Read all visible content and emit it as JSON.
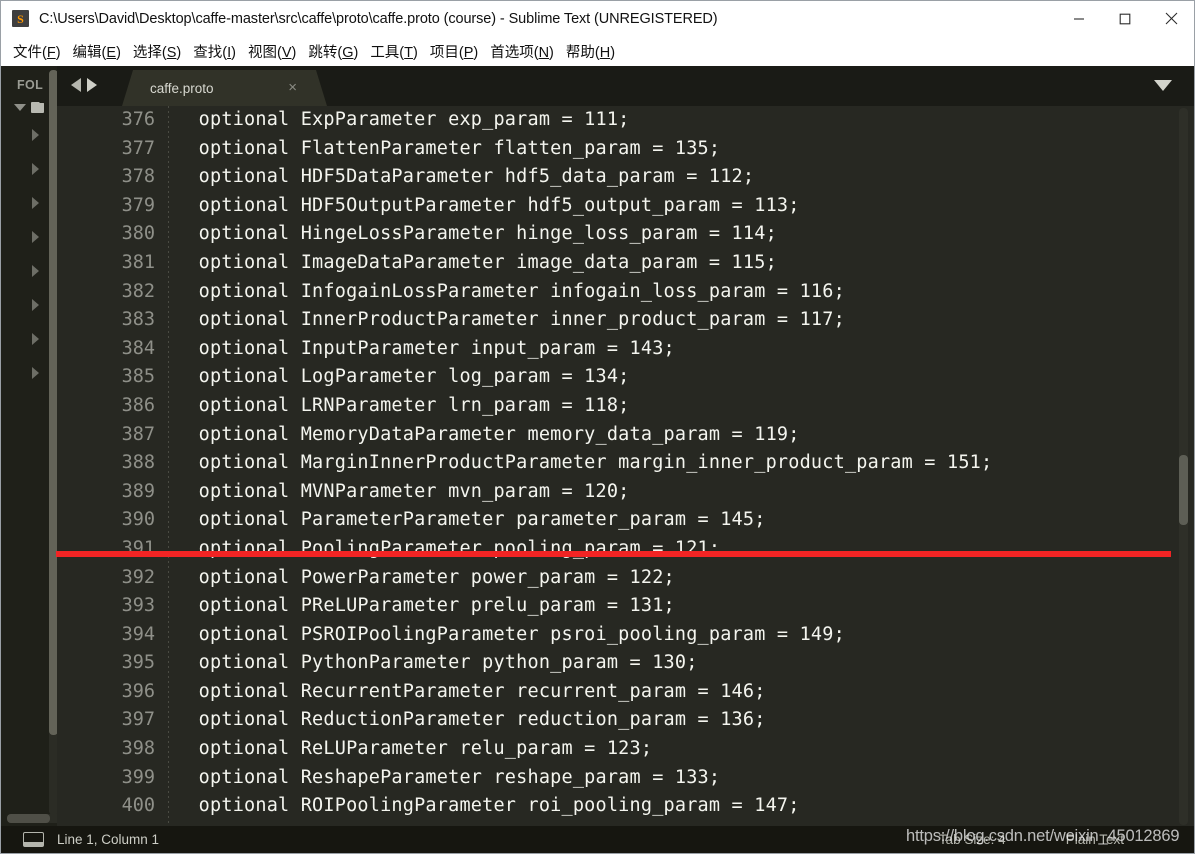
{
  "window": {
    "title": "C:\\Users\\David\\Desktop\\caffe-master\\src\\caffe\\proto\\caffe.proto (course) - Sublime Text (UNREGISTERED)",
    "logo_glyph": "S",
    "controls": {
      "minimize": "minimize-button",
      "maximize": "maximize-button",
      "close": "close-button"
    }
  },
  "menubar": {
    "items": [
      {
        "label": "文件(F)",
        "mnemonic": "F"
      },
      {
        "label": "编辑(E)",
        "mnemonic": "E"
      },
      {
        "label": "选择(S)",
        "mnemonic": "S"
      },
      {
        "label": "查找(I)",
        "mnemonic": "I"
      },
      {
        "label": "视图(V)",
        "mnemonic": "V"
      },
      {
        "label": "跳转(G)",
        "mnemonic": "G"
      },
      {
        "label": "工具(T)",
        "mnemonic": "T"
      },
      {
        "label": "项目(P)",
        "mnemonic": "P"
      },
      {
        "label": "首选项(N)",
        "mnemonic": "N"
      },
      {
        "label": "帮助(H)",
        "mnemonic": "H"
      }
    ]
  },
  "sidebar": {
    "header": "FOL",
    "child_count": 8
  },
  "tabbar": {
    "tabs": [
      {
        "label": "caffe.proto",
        "close": "×",
        "active": true
      }
    ]
  },
  "editor": {
    "first_line_number": 376,
    "lines": [
      {
        "num": "376",
        "text": "  optional ExpParameter exp_param = 111;"
      },
      {
        "num": "377",
        "text": "  optional FlattenParameter flatten_param = 135;"
      },
      {
        "num": "378",
        "text": "  optional HDF5DataParameter hdf5_data_param = 112;"
      },
      {
        "num": "379",
        "text": "  optional HDF5OutputParameter hdf5_output_param = 113;"
      },
      {
        "num": "380",
        "text": "  optional HingeLossParameter hinge_loss_param = 114;"
      },
      {
        "num": "381",
        "text": "  optional ImageDataParameter image_data_param = 115;"
      },
      {
        "num": "382",
        "text": "  optional InfogainLossParameter infogain_loss_param = 116;"
      },
      {
        "num": "383",
        "text": "  optional InnerProductParameter inner_product_param = 117;"
      },
      {
        "num": "384",
        "text": "  optional InputParameter input_param = 143;"
      },
      {
        "num": "385",
        "text": "  optional LogParameter log_param = 134;"
      },
      {
        "num": "386",
        "text": "  optional LRNParameter lrn_param = 118;"
      },
      {
        "num": "387",
        "text": "  optional MemoryDataParameter memory_data_param = 119;"
      },
      {
        "num": "388",
        "text": "  optional MarginInnerProductParameter margin_inner_product_param = 151;"
      },
      {
        "num": "389",
        "text": "  optional MVNParameter mvn_param = 120;"
      },
      {
        "num": "390",
        "text": "  optional ParameterParameter parameter_param = 145;"
      },
      {
        "num": "391",
        "text": "  optional PoolingParameter pooling_param = 121;"
      },
      {
        "num": "392",
        "text": "  optional PowerParameter power_param = 122;"
      },
      {
        "num": "393",
        "text": "  optional PReLUParameter prelu_param = 131;"
      },
      {
        "num": "394",
        "text": "  optional PSROIPoolingParameter psroi_pooling_param = 149;"
      },
      {
        "num": "395",
        "text": "  optional PythonParameter python_param = 130;"
      },
      {
        "num": "396",
        "text": "  optional RecurrentParameter recurrent_param = 146;"
      },
      {
        "num": "397",
        "text": "  optional ReductionParameter reduction_param = 136;"
      },
      {
        "num": "398",
        "text": "  optional ReLUParameter relu_param = 123;"
      },
      {
        "num": "399",
        "text": "  optional ReshapeParameter reshape_param = 133;"
      },
      {
        "num": "400",
        "text": "  optional ROIPoolingParameter roi_pooling_param = 147;"
      }
    ]
  },
  "annotation": {
    "type": "red-underline",
    "color": "#f22424",
    "target_line": "389"
  },
  "statusbar": {
    "position": "Line 1, Column 1",
    "tab_size": "Tab Size: 4",
    "syntax": "Plain Text"
  },
  "watermark": {
    "text": "https://blog.csdn.net/weixin_45012869"
  },
  "colors": {
    "editor_bg": "#272822",
    "gutter_text": "#8f9089",
    "code_text": "#f4f5ef",
    "tabbar_bg": "#1a1b16",
    "sidebar_bg": "#1f2019",
    "statusbar_bg": "#161610",
    "accent_red": "#f22424",
    "titlebar_bg": "#ffffff"
  }
}
